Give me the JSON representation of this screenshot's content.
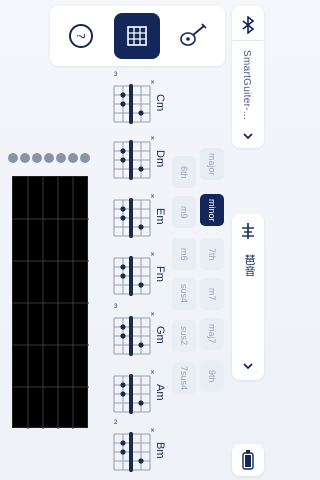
{
  "app": {
    "title": "SmartGuiter-..."
  },
  "rail": {
    "tuner_label": "琶音"
  },
  "qualities": [
    {
      "label": "major",
      "active": false
    },
    {
      "label": "minor",
      "active": true
    },
    {
      "label": "7th",
      "active": false
    },
    {
      "label": "6th",
      "active": false
    },
    {
      "label": "m9",
      "active": false
    },
    {
      "label": "m6",
      "active": false
    },
    {
      "label": "m7",
      "active": false
    },
    {
      "label": "maj7",
      "active": false
    },
    {
      "label": "sus4",
      "active": false
    },
    {
      "label": "sus2",
      "active": false
    },
    {
      "label": "9th",
      "active": false
    },
    {
      "label": "7sus4",
      "active": false
    }
  ],
  "chords": [
    {
      "name": "Cm",
      "fret_start": "3"
    },
    {
      "name": "Dm",
      "fret_start": ""
    },
    {
      "name": "Em",
      "fret_start": ""
    },
    {
      "name": "Fm",
      "fret_start": ""
    },
    {
      "name": "Gm",
      "fret_start": "3"
    },
    {
      "name": "Am",
      "fret_start": ""
    },
    {
      "name": "Bm",
      "fret_start": "2"
    }
  ],
  "fret_markers": [
    "",
    "",
    "",
    "",
    "",
    "",
    ""
  ]
}
